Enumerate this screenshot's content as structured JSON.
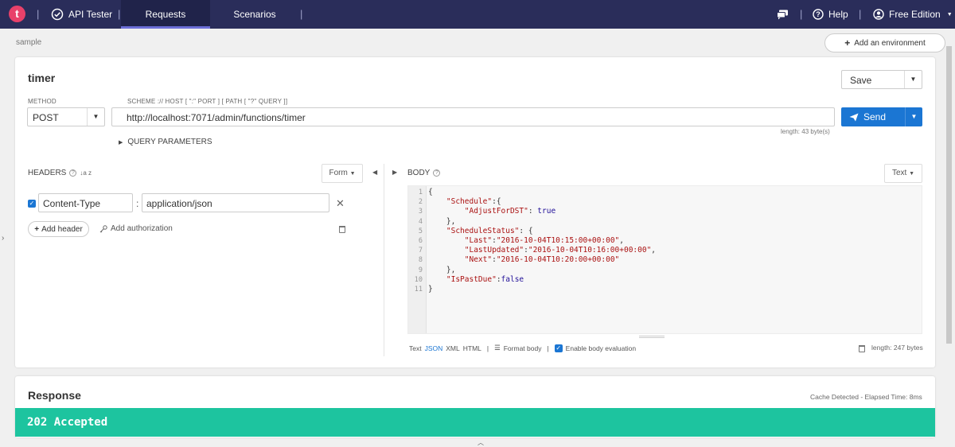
{
  "topbar": {
    "logo_letter": "t",
    "app_name": "API Tester",
    "tabs": [
      {
        "label": "Requests",
        "active": true
      },
      {
        "label": "Scenarios",
        "active": false
      }
    ],
    "help_label": "Help",
    "edition_label": "Free Edition",
    "separator": "|"
  },
  "env": {
    "name": "sample",
    "add_label": "Add an environment"
  },
  "request": {
    "title": "timer",
    "save_label": "Save",
    "method_label": "METHOD",
    "method_value": "POST",
    "url_label": "SCHEME :// HOST [ \":\" PORT ] [ PATH [ \"?\" QUERY ]]",
    "url_value": "http://localhost:7071/admin/functions/timer",
    "url_length": "length: 43 byte(s)",
    "send_label": "Send",
    "query_params_label": "QUERY PARAMETERS"
  },
  "headers": {
    "label": "HEADERS",
    "sort_icon_text": "↓a z",
    "form_label": "Form",
    "rows": [
      {
        "enabled": true,
        "name": "Content-Type",
        "value": "application/json"
      }
    ],
    "add_header_label": "Add header",
    "add_auth_label": "Add authorization"
  },
  "body": {
    "label": "BODY",
    "format_label": "Text",
    "lines": [
      "{",
      "    \"Schedule\":{",
      "        \"AdjustForDST\": true",
      "    },",
      "    \"ScheduleStatus\": {",
      "        \"Last\":\"2016-10-04T10:15:00+00:00\",",
      "        \"LastUpdated\":\"2016-10-04T10:16:00+00:00\",",
      "        \"Next\":\"2016-10-04T10:20:00+00:00\"",
      "    },",
      "    \"IsPastDue\":false",
      "}"
    ],
    "footer": {
      "modes": [
        "Text",
        "JSON",
        "XML",
        "HTML"
      ],
      "active_mode": "JSON",
      "format_body": "Format body",
      "enable_eval": "Enable body evaluation",
      "length": "length: 247 bytes"
    }
  },
  "response": {
    "title": "Response",
    "meta": "Cache Detected - Elapsed Time: 8ms",
    "status": "202 Accepted",
    "status_color": "#1dc49f"
  },
  "colors": {
    "nav_bg": "#2a2d5a",
    "accent": "#1b76d3"
  }
}
